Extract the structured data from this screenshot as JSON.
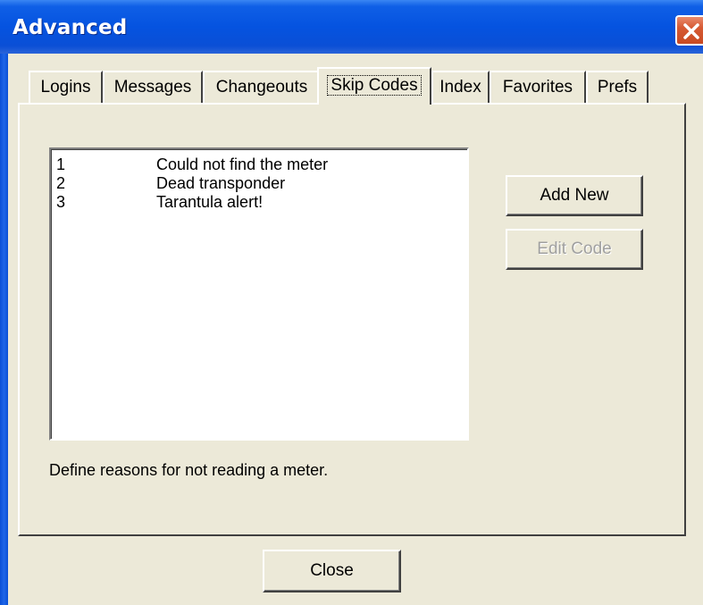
{
  "window": {
    "title": "Advanced",
    "close_icon": "close-x-icon",
    "colors": {
      "titlebar": "#0553e0",
      "close_button": "#d65a34",
      "face": "#ece9d8"
    }
  },
  "tabs": [
    {
      "label": "Logins",
      "active": false
    },
    {
      "label": "Messages",
      "active": false
    },
    {
      "label": "Changeouts",
      "active": false
    },
    {
      "label": "Skip Codes",
      "active": true
    },
    {
      "label": "Index",
      "active": false
    },
    {
      "label": "Favorites",
      "active": false
    },
    {
      "label": "Prefs",
      "active": false
    }
  ],
  "skip_codes": [
    {
      "code": "1",
      "description": "Could not find the meter"
    },
    {
      "code": "2",
      "description": "Dead transponder"
    },
    {
      "code": "3",
      "description": "Tarantula alert!"
    }
  ],
  "buttons": {
    "add_new": "Add New",
    "edit_code": "Edit Code",
    "close": "Close"
  },
  "hint": "Define reasons for not reading a meter."
}
